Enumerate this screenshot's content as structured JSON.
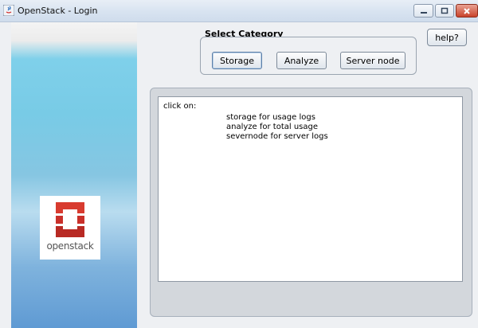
{
  "window": {
    "title": "OpenStack - Login"
  },
  "branding": {
    "logo_text": "openstack",
    "logo_color": "#d32f2f"
  },
  "category": {
    "title": "Select Category",
    "buttons": [
      "Storage",
      "Analyze",
      "Server node"
    ]
  },
  "help_label": "help?",
  "output": {
    "label": "click on:",
    "lines": [
      "storage for usage logs",
      "analyze for total usage",
      "severnode for server logs"
    ]
  },
  "colors": {
    "accent": "#5c7fa8",
    "close_button": "#c9432b"
  }
}
